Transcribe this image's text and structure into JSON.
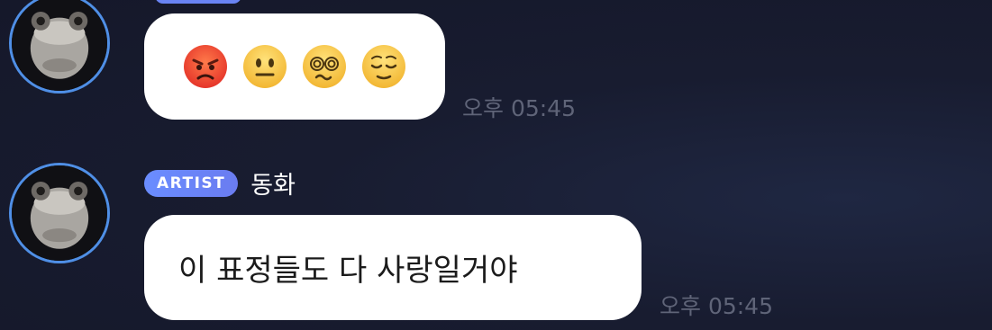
{
  "messages": [
    {
      "content_type": "emoji",
      "emojis": [
        "angry-face-icon",
        "neutral-face-icon",
        "dizzy-face-icon",
        "relieved-face-icon"
      ],
      "time": "오후 05:45"
    },
    {
      "badge": "ARTIST",
      "sender": "동화",
      "text": "이 표정들도 다 사랑일거야",
      "time": "오후 05:45"
    }
  ],
  "colors": {
    "background": "#181c30",
    "avatar_ring": "#4f8fe6",
    "badge": "#6a84f4",
    "bubble": "#ffffff",
    "timestamp": "#5f6478"
  }
}
